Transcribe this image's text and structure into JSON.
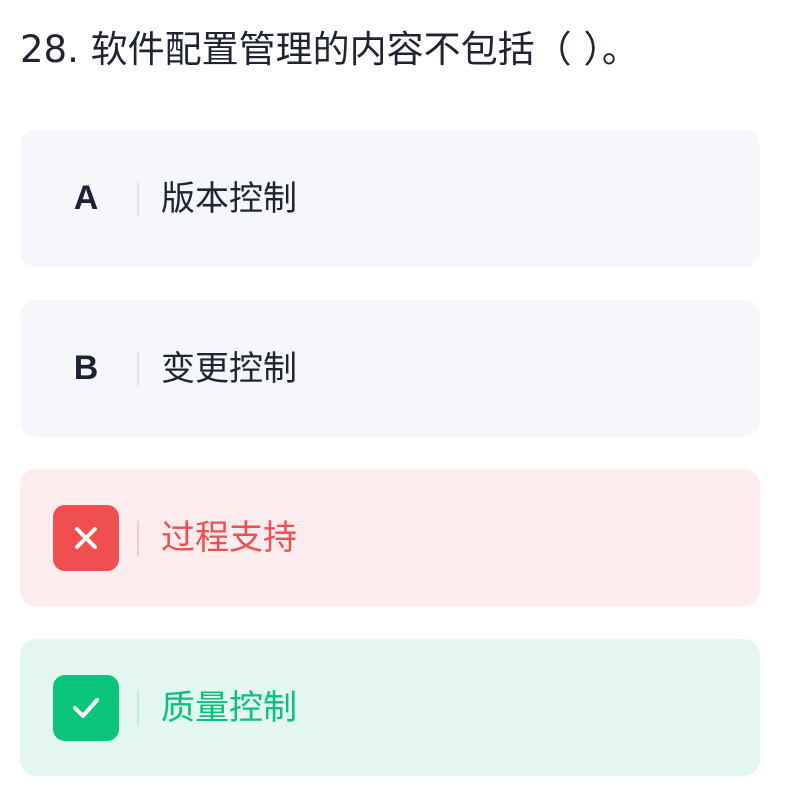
{
  "question": {
    "text": "28. 软件配置管理的内容不包括（ ）。"
  },
  "options": [
    {
      "letter": "A",
      "text": "版本控制",
      "state": "neutral"
    },
    {
      "letter": "B",
      "text": "变更控制",
      "state": "neutral"
    },
    {
      "letter": "",
      "text": "过程支持",
      "state": "wrong",
      "icon": "close-icon"
    },
    {
      "letter": "",
      "text": "质量控制",
      "state": "correct",
      "icon": "check-icon"
    }
  ],
  "colors": {
    "wrong": "#ef4f50",
    "correct": "#09c47a",
    "neutral_bg": "#f6f7fb",
    "wrong_bg": "#fdecee",
    "correct_bg": "#e4f6f0"
  }
}
